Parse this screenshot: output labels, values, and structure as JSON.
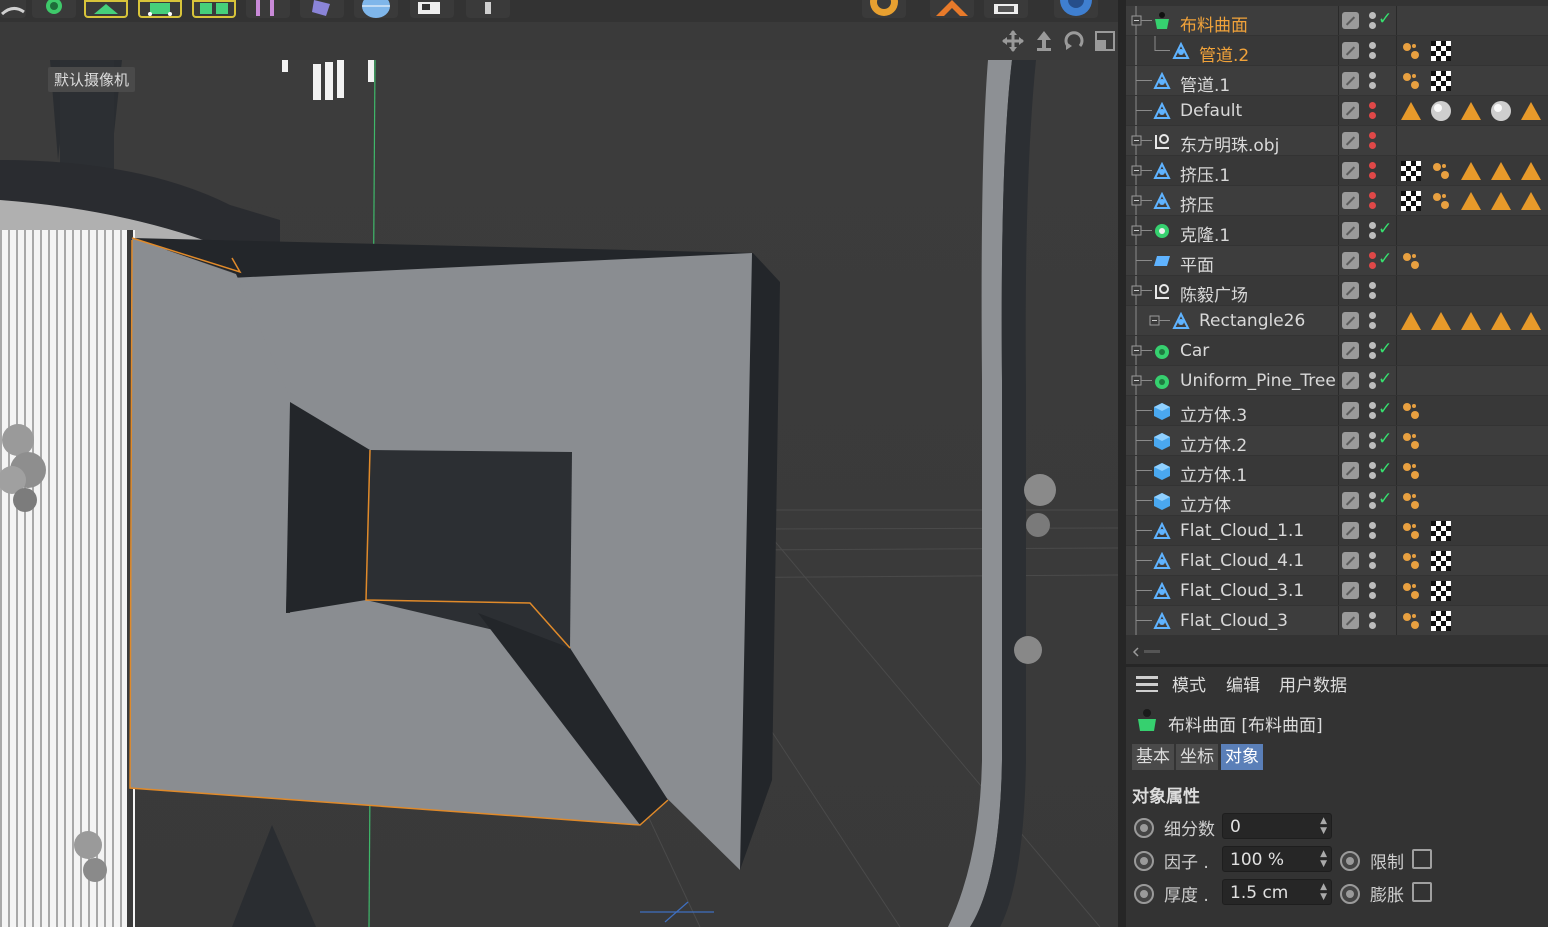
{
  "viewport": {
    "camera_label": "默认摄像机"
  },
  "object_manager": {
    "objects": [
      {
        "name": "布料曲面",
        "icon": "cloth-surface-icon",
        "selected": true,
        "checked": true
      },
      {
        "name": "管道.2",
        "icon": "polygon-object-icon",
        "selected": true,
        "checked": false
      },
      {
        "name": "管道.1",
        "icon": "polygon-object-icon",
        "selected": false,
        "checked": false
      },
      {
        "name": "Default",
        "icon": "polygon-object-icon",
        "selected": false,
        "checked": false
      },
      {
        "name": "东方明珠.obj",
        "icon": "null-object-icon",
        "selected": false,
        "checked": false
      },
      {
        "name": "挤压.1",
        "icon": "polygon-object-icon",
        "selected": false,
        "checked": false
      },
      {
        "name": "挤压",
        "icon": "polygon-object-icon",
        "selected": false,
        "checked": false
      },
      {
        "name": "克隆.1",
        "icon": "cloner-icon",
        "selected": false,
        "checked": true
      },
      {
        "name": "平面",
        "icon": "plane-icon",
        "selected": false,
        "checked": true
      },
      {
        "name": "陈毅广场",
        "icon": "null-object-icon",
        "selected": false,
        "checked": false
      },
      {
        "name": "Rectangle26",
        "icon": "polygon-object-icon",
        "selected": false,
        "checked": false
      },
      {
        "name": "Car",
        "icon": "group-icon",
        "selected": false,
        "checked": true
      },
      {
        "name": "Uniform_Pine_Tree",
        "icon": "group-icon",
        "selected": false,
        "checked": true
      },
      {
        "name": "立方体.3",
        "icon": "cube-icon",
        "selected": false,
        "checked": true
      },
      {
        "name": "立方体.2",
        "icon": "cube-icon",
        "selected": false,
        "checked": true
      },
      {
        "name": "立方体.1",
        "icon": "cube-icon",
        "selected": false,
        "checked": true
      },
      {
        "name": "立方体",
        "icon": "cube-icon",
        "selected": false,
        "checked": true
      },
      {
        "name": "Flat_Cloud_1.1",
        "icon": "polygon-object-icon",
        "selected": false,
        "checked": false
      },
      {
        "name": "Flat_Cloud_4.1",
        "icon": "polygon-object-icon",
        "selected": false,
        "checked": false
      },
      {
        "name": "Flat_Cloud_3.1",
        "icon": "polygon-object-icon",
        "selected": false,
        "checked": false
      },
      {
        "name": "Flat_Cloud_3",
        "icon": "polygon-object-icon",
        "selected": false,
        "checked": false
      }
    ]
  },
  "attribute_manager": {
    "menu": [
      "模式",
      "编辑",
      "用户数据"
    ],
    "title": "布料曲面 [布料曲面]",
    "tabs": [
      {
        "label": "基本",
        "active": false
      },
      {
        "label": "坐标",
        "active": false
      },
      {
        "label": "对象",
        "active": true
      }
    ],
    "section": "对象属性",
    "properties": [
      {
        "label": "细分数",
        "value": "0"
      },
      {
        "label": "因子 .",
        "value": "100 %"
      },
      {
        "label": "厚度 .",
        "value": "1.5 cm"
      }
    ],
    "limit_label": "限制",
    "expand_label": "膨胀"
  },
  "colors": {
    "accent_selected": "#f0a23a",
    "check_green": "#36e06f",
    "tab_active": "#5a7fb8",
    "model_gray": "#8a8d91",
    "selection_outline": "#e08a2a"
  }
}
